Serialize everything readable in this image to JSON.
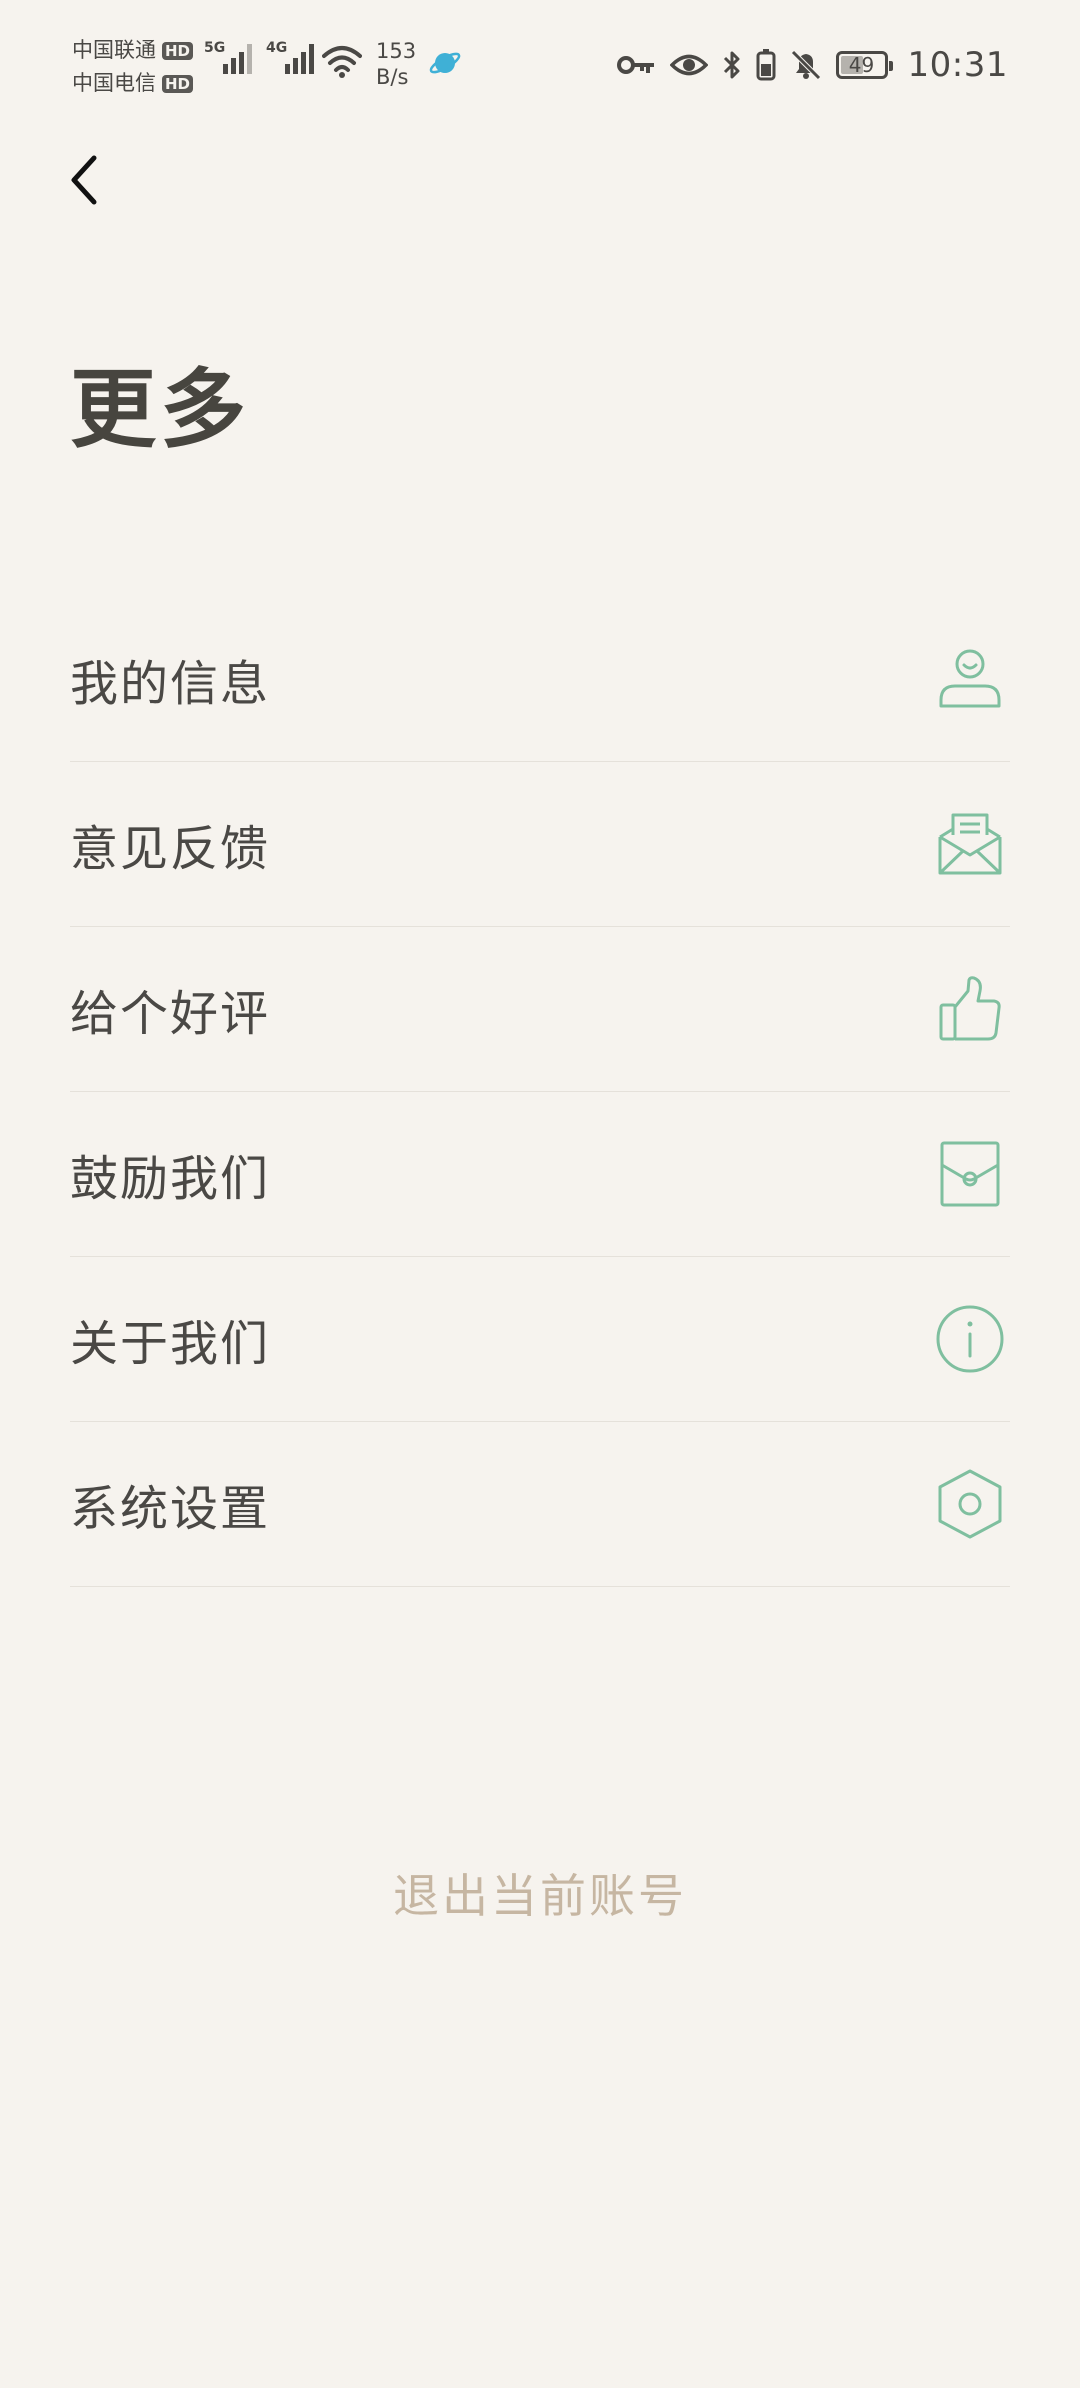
{
  "status_bar": {
    "carrier_1": "中国联通",
    "carrier_2": "中国电信",
    "hd_badge": "HD",
    "network_1": "5G",
    "network_2": "4G",
    "net_speed_value": "153",
    "net_speed_unit": "B/s",
    "battery_level": "49",
    "battery_fraction": 0.49,
    "time": "10:31",
    "icons": [
      "key-icon",
      "eye-icon",
      "bluetooth-icon",
      "battery-saver-icon",
      "notifications-off-icon"
    ]
  },
  "header": {
    "back_icon": "chevron-left-icon",
    "title": "更多"
  },
  "menu": [
    {
      "label": "我的信息",
      "icon": "user-icon"
    },
    {
      "label": "意见反馈",
      "icon": "envelope-letter-icon"
    },
    {
      "label": "给个好评",
      "icon": "thumbs-up-icon"
    },
    {
      "label": "鼓励我们",
      "icon": "gift-envelope-icon"
    },
    {
      "label": "关于我们",
      "icon": "info-icon"
    },
    {
      "label": "系统设置",
      "icon": "hex-settings-icon"
    }
  ],
  "logout_label": "退出当前账号",
  "colors": {
    "background": "#f6f3ee",
    "text": "#4a4845",
    "icon_accent": "#7fbf9f",
    "divider": "#e5e1da",
    "logout_text": "#c6b6a2"
  }
}
